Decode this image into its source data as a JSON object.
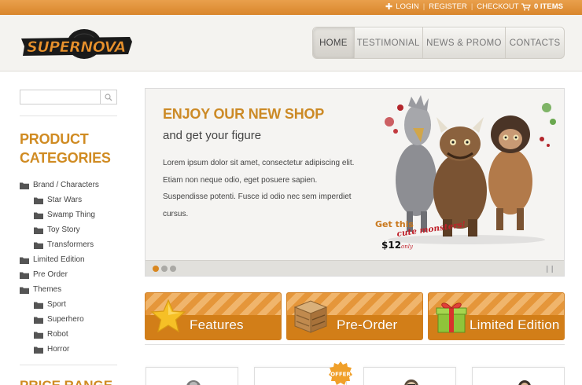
{
  "topbar": {
    "login": "LOGIN",
    "register": "REGISTER",
    "checkout": "CHECKOUT",
    "cart_label": "0 ITEMS"
  },
  "brand": {
    "logo_text": "SUPERNOVA"
  },
  "nav": {
    "items": [
      "HOME",
      "TESTIMONIAL",
      "NEWS & PROMO",
      "CONTACTS"
    ],
    "active": "HOME"
  },
  "search": {
    "placeholder": ""
  },
  "sidebar": {
    "categories_title": "PRODUCT CATEGORIES",
    "tree": [
      {
        "label": "Brand / Characters",
        "level": 0
      },
      {
        "label": "Star Wars",
        "level": 1
      },
      {
        "label": "Swamp Thing",
        "level": 1
      },
      {
        "label": "Toy Story",
        "level": 1
      },
      {
        "label": "Transformers",
        "level": 1
      },
      {
        "label": "Limited Edition",
        "level": 0
      },
      {
        "label": "Pre Order",
        "level": 0
      },
      {
        "label": "Themes",
        "level": 0
      },
      {
        "label": "Sport",
        "level": 1
      },
      {
        "label": "Superhero",
        "level": 1
      },
      {
        "label": "Robot",
        "level": 1
      },
      {
        "label": "Horror",
        "level": 1
      }
    ],
    "price_title": "PRICE RANGE"
  },
  "slider": {
    "title": "ENJOY OUR NEW SHOP",
    "subtitle": "and get your figure",
    "text": "Lorem ipsum dolor sit amet, consectetur adipiscing elit. Etiam non neque odio, eget posuere sapien. Suspendisse potenti. Fusce id odio nec sem imperdiet cursus.",
    "promo_line1": "Get this",
    "promo_line2": "cute monsters!",
    "price": "$12",
    "price_suffix": "only",
    "active_dot": 0
  },
  "promos": [
    {
      "label": "Features",
      "icon": "star-icon"
    },
    {
      "label": "Pre-Order",
      "icon": "crate-icon"
    },
    {
      "label": "Limited Edition",
      "icon": "gift-icon"
    }
  ],
  "badge": {
    "offer": "OFFER"
  },
  "colors": {
    "accent": "#d9871f",
    "accent_dark": "#d27e18",
    "heading": "#d08b22"
  }
}
